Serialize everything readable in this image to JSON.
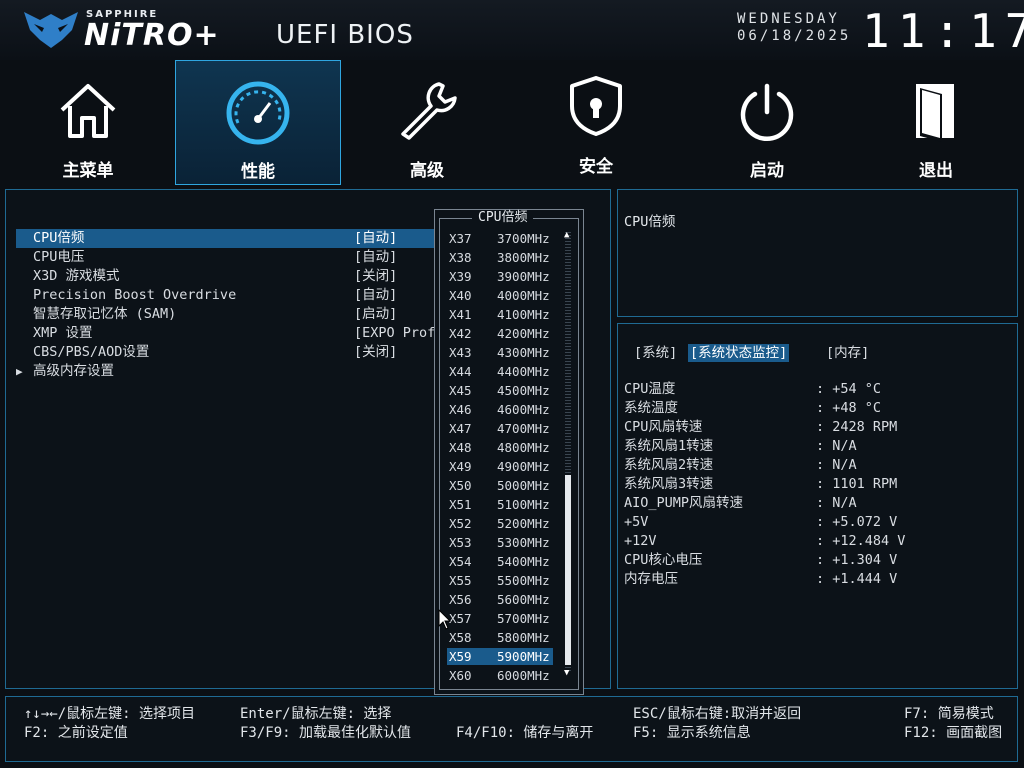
{
  "header": {
    "brand_small": "SAPPHIRE",
    "brand_big": "NiTRO+",
    "title": "UEFI BIOS",
    "weekday": "WEDNESDAY",
    "date": "06/18/2025",
    "time": "11:17"
  },
  "nav": {
    "tabs": [
      {
        "label": "主菜单",
        "icon": "home-icon"
      },
      {
        "label": "性能",
        "icon": "speedometer-icon"
      },
      {
        "label": "高级",
        "icon": "wrench-icon"
      },
      {
        "label": "安全",
        "icon": "shield-lock-icon"
      },
      {
        "label": "启动",
        "icon": "power-icon"
      },
      {
        "label": "退出",
        "icon": "exit-door-icon"
      }
    ],
    "active_index": 1
  },
  "colors": {
    "accent": "#1a5b8c",
    "border": "#1f6a93",
    "background": "#0b0f14"
  },
  "menu": {
    "items": [
      {
        "label": "CPU倍频",
        "value": "[自动]"
      },
      {
        "label": "CPU电压",
        "value": "[自动]"
      },
      {
        "label": "X3D 游戏模式",
        "value": "[关闭]"
      },
      {
        "label": "Precision Boost Overdrive",
        "value": "[自动]"
      },
      {
        "label": "智慧存取记忆体 (SAM)",
        "value": "[启动]"
      },
      {
        "label": "XMP 设置",
        "value": "[EXPO Prof"
      },
      {
        "label": "CBS/PBS/AOD设置",
        "value": "[关闭]"
      },
      {
        "label": "高级内存设置",
        "value": ""
      }
    ],
    "submenu_arrow": "▶"
  },
  "popup": {
    "title": "CPU倍频",
    "options": [
      {
        "mult": "X37",
        "freq": "3700MHz"
      },
      {
        "mult": "X38",
        "freq": "3800MHz"
      },
      {
        "mult": "X39",
        "freq": "3900MHz"
      },
      {
        "mult": "X40",
        "freq": "4000MHz"
      },
      {
        "mult": "X41",
        "freq": "4100MHz"
      },
      {
        "mult": "X42",
        "freq": "4200MHz"
      },
      {
        "mult": "X43",
        "freq": "4300MHz"
      },
      {
        "mult": "X44",
        "freq": "4400MHz"
      },
      {
        "mult": "X45",
        "freq": "4500MHz"
      },
      {
        "mult": "X46",
        "freq": "4600MHz"
      },
      {
        "mult": "X47",
        "freq": "4700MHz"
      },
      {
        "mult": "X48",
        "freq": "4800MHz"
      },
      {
        "mult": "X49",
        "freq": "4900MHz"
      },
      {
        "mult": "X50",
        "freq": "5000MHz"
      },
      {
        "mult": "X51",
        "freq": "5100MHz"
      },
      {
        "mult": "X52",
        "freq": "5200MHz"
      },
      {
        "mult": "X53",
        "freq": "5300MHz"
      },
      {
        "mult": "X54",
        "freq": "5400MHz"
      },
      {
        "mult": "X55",
        "freq": "5500MHz"
      },
      {
        "mult": "X56",
        "freq": "5600MHz"
      },
      {
        "mult": "X57",
        "freq": "5700MHz"
      },
      {
        "mult": "X58",
        "freq": "5800MHz"
      },
      {
        "mult": "X59",
        "freq": "5900MHz"
      },
      {
        "mult": "X60",
        "freq": "6000MHz"
      }
    ],
    "selected_index": 22
  },
  "help": {
    "text": "CPU倍频"
  },
  "monitor": {
    "tabs": [
      "[系统]",
      "[系统状态监控]",
      "[内存]"
    ],
    "selected_tab": 1,
    "rows": [
      {
        "key": "CPU温度",
        "value": ": +54 °C"
      },
      {
        "key": "系统温度",
        "value": ": +48 °C"
      },
      {
        "key": "CPU风扇转速",
        "value": ": 2428 RPM"
      },
      {
        "key": "系统风扇1转速",
        "value": ": N/A"
      },
      {
        "key": "系统风扇2转速",
        "value": ": N/A"
      },
      {
        "key": "系统风扇3转速",
        "value": ": 1101 RPM"
      },
      {
        "key": "AIO_PUMP风扇转速",
        "value": ": N/A"
      },
      {
        "key": "+5V",
        "value": ": +5.072 V"
      },
      {
        "key": "+12V",
        "value": ": +12.484 V"
      },
      {
        "key": "CPU核心电压",
        "value": ": +1.304 V"
      },
      {
        "key": "内存电压",
        "value": ": +1.444 V"
      }
    ]
  },
  "footer": {
    "hints": [
      "↑↓→←/鼠标左键: 选择项目",
      "Enter/鼠标左键: 选择",
      "ESC/鼠标右键:取消并返回",
      "F7: 简易模式",
      "F2: 之前设定值",
      "F3/F9: 加载最佳化默认值",
      "F4/F10: 储存与离开",
      "F5: 显示系统信息",
      "F12: 画面截图"
    ]
  }
}
